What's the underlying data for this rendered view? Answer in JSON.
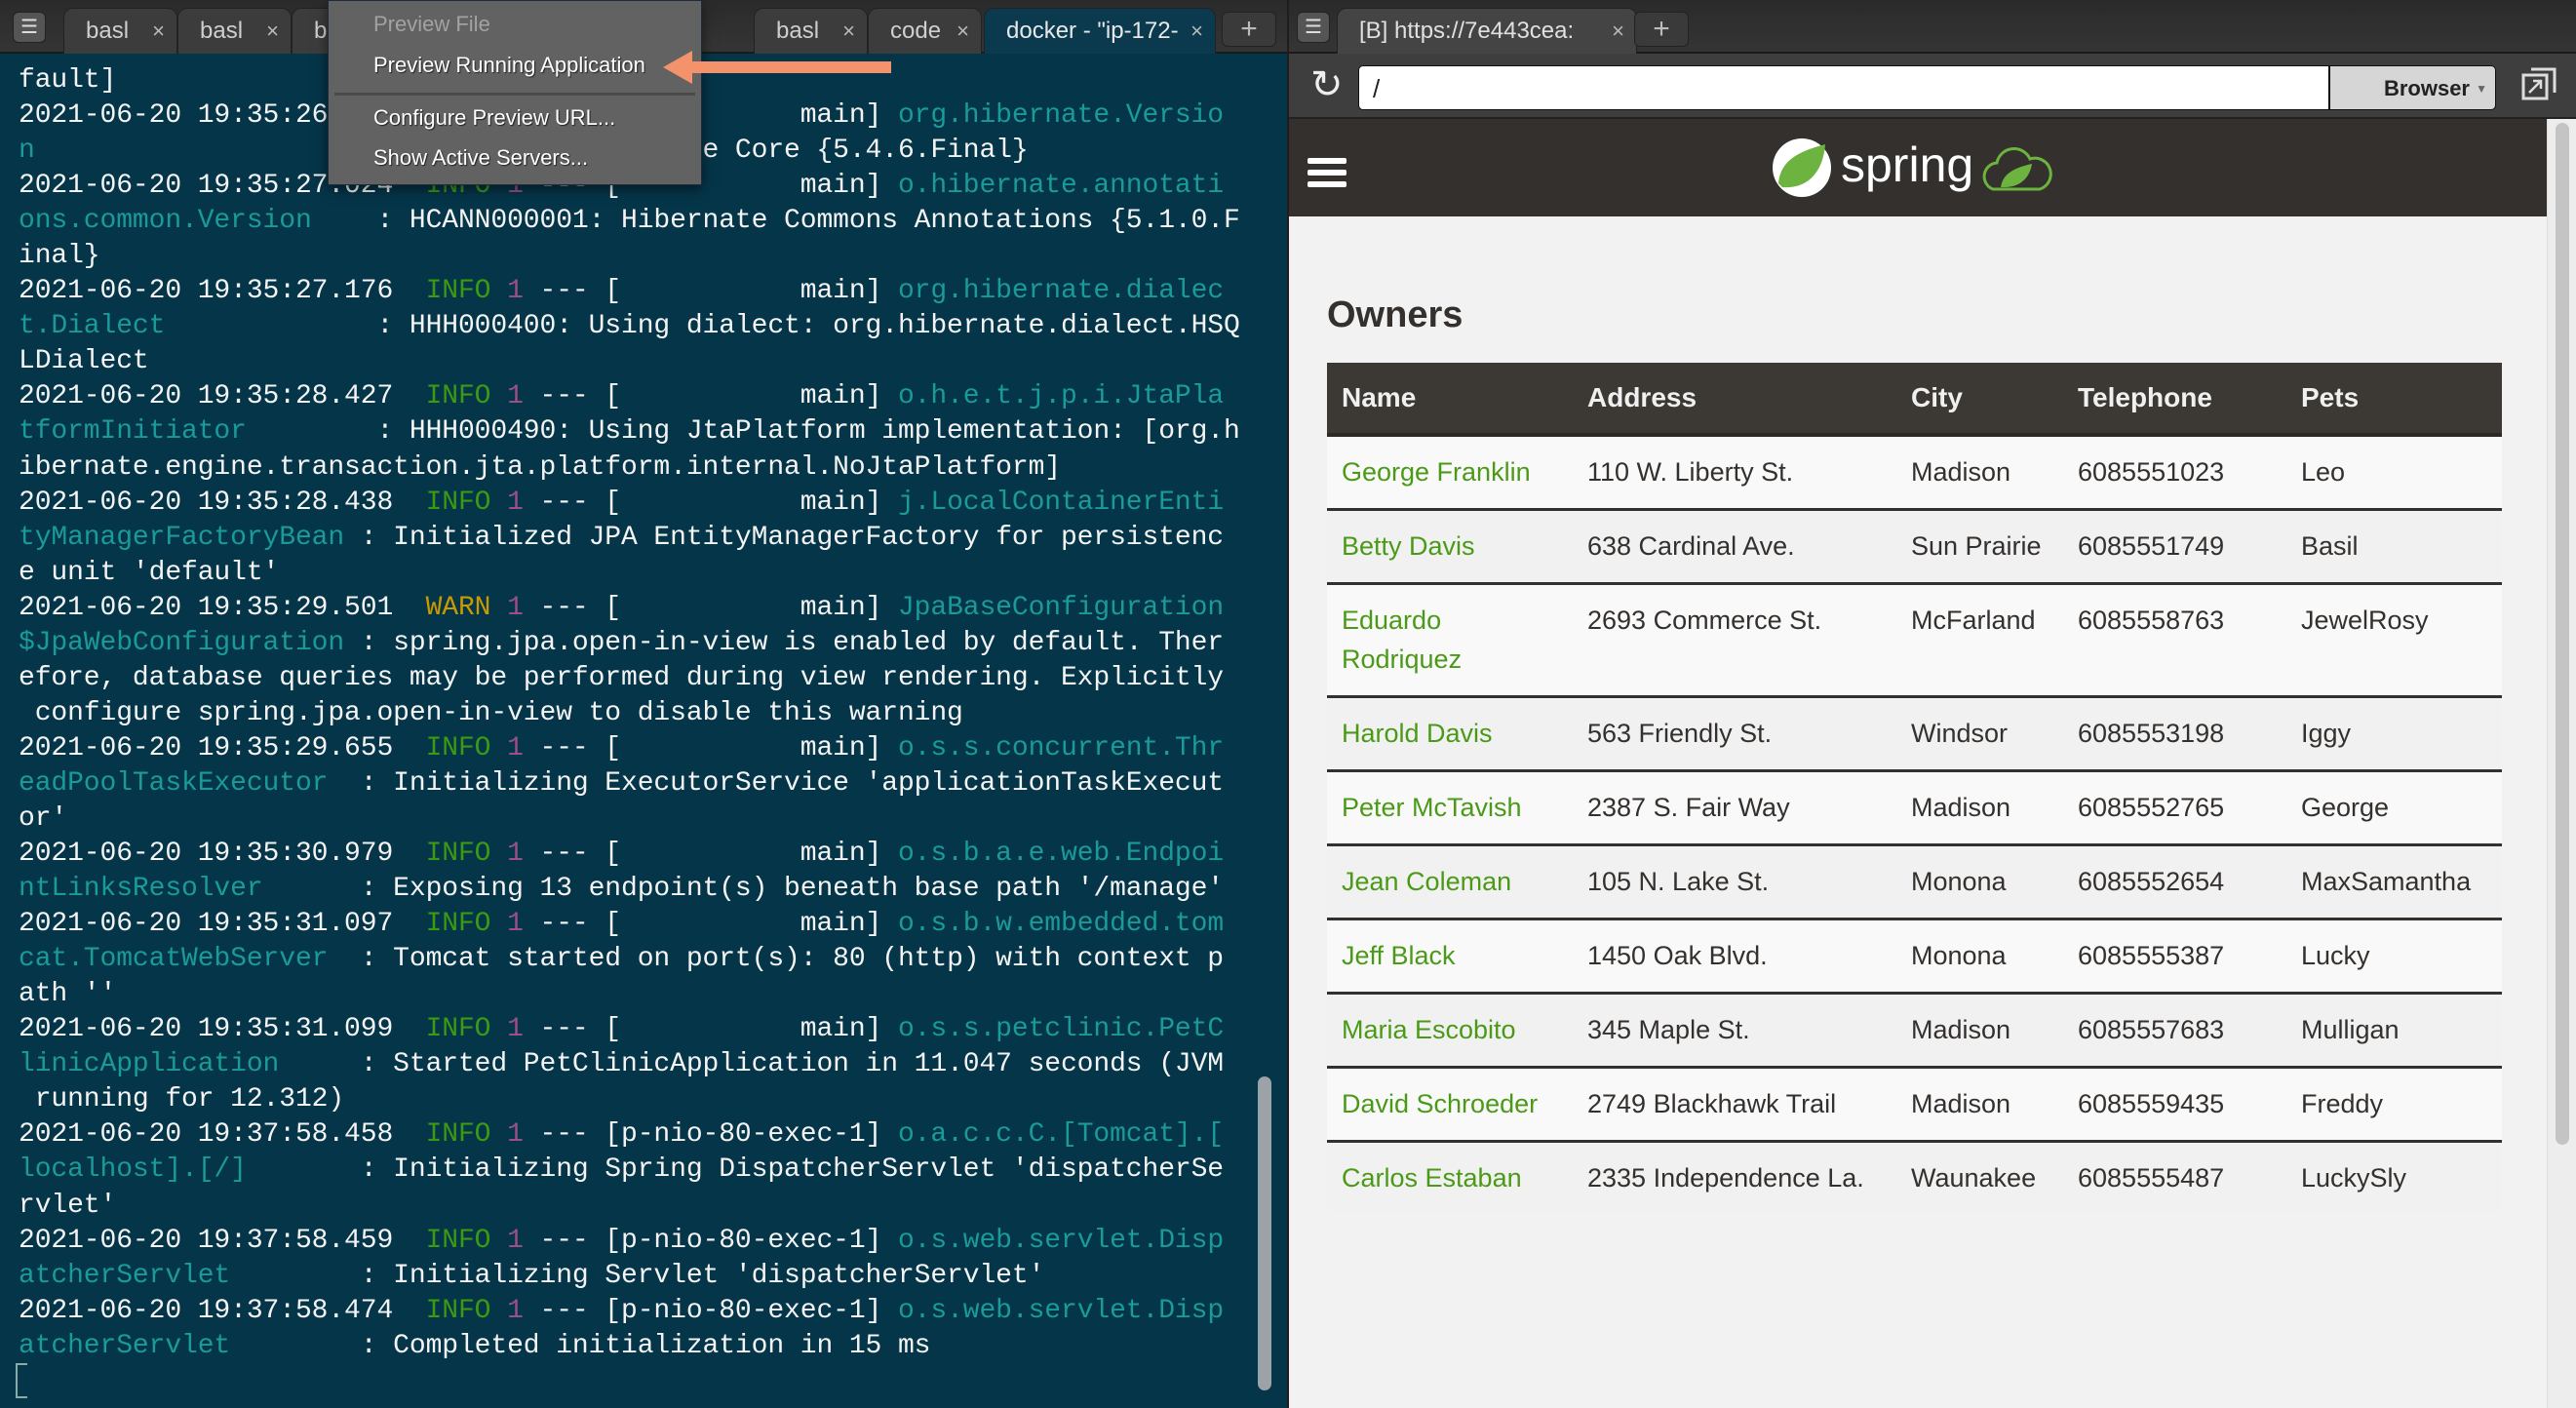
{
  "colors": {
    "terminal_bg": "#053549",
    "info": "#3a9a12",
    "warn": "#c79a00",
    "pid": "#9a4f86",
    "logger": "#1a9a98",
    "link_green": "#4b9a17",
    "spring_green": "#6db33f",
    "header_dark": "#34302d",
    "arrow": "#f4926c"
  },
  "left_tabs": [
    {
      "label": "basl",
      "active": false
    },
    {
      "label": "basl",
      "active": false
    },
    {
      "label": "b",
      "active": false
    },
    {
      "label": "",
      "active": false
    },
    {
      "label": "basl",
      "active": false
    },
    {
      "label": "code",
      "active": false
    },
    {
      "label": "docker - \"ip-172-",
      "active": true
    }
  ],
  "preview_menu": {
    "items": [
      {
        "label": "Preview File",
        "disabled": true
      },
      {
        "label": "Preview Running Application",
        "disabled": false
      },
      {
        "label": "Configure Preview URL...",
        "disabled": false
      },
      {
        "label": "Show Active Servers...",
        "disabled": false
      }
    ]
  },
  "terminal": {
    "lines": [
      [
        {
          "t": "fault]",
          "c": "w"
        }
      ],
      [
        {
          "t": "2021-06-20 19:35:26                             main] ",
          "c": "w"
        },
        {
          "t": "org.hibernate.Versio",
          "c": "t"
        }
      ],
      [
        {
          "t": "n",
          "c": "t"
        },
        {
          "t": "                                        te Core {5.4.6.Final}",
          "c": "w"
        }
      ],
      [
        {
          "t": "2021-06-20 19:35:27.024  ",
          "c": "w"
        },
        {
          "t": "INFO",
          "c": "g"
        },
        {
          "t": " ",
          "c": "w"
        },
        {
          "t": "1",
          "c": "p"
        },
        {
          "t": " --- [           main] ",
          "c": "w"
        },
        {
          "t": "o.hibernate.annotati",
          "c": "t"
        }
      ],
      [
        {
          "t": "ons.common.Version",
          "c": "t"
        },
        {
          "t": "    : HCANN000001: Hibernate Commons Annotations {5.1.0.F",
          "c": "w"
        }
      ],
      [
        {
          "t": "inal}",
          "c": "w"
        }
      ],
      [
        {
          "t": "2021-06-20 19:35:27.176  ",
          "c": "w"
        },
        {
          "t": "INFO",
          "c": "g"
        },
        {
          "t": " ",
          "c": "w"
        },
        {
          "t": "1",
          "c": "p"
        },
        {
          "t": " --- [           main] ",
          "c": "w"
        },
        {
          "t": "org.hibernate.dialec",
          "c": "t"
        }
      ],
      [
        {
          "t": "t.Dialect",
          "c": "t"
        },
        {
          "t": "             : HHH000400: Using dialect: org.hibernate.dialect.HSQ",
          "c": "w"
        }
      ],
      [
        {
          "t": "LDialect",
          "c": "w"
        }
      ],
      [
        {
          "t": "2021-06-20 19:35:28.427  ",
          "c": "w"
        },
        {
          "t": "INFO",
          "c": "g"
        },
        {
          "t": " ",
          "c": "w"
        },
        {
          "t": "1",
          "c": "p"
        },
        {
          "t": " --- [           main] ",
          "c": "w"
        },
        {
          "t": "o.h.e.t.j.p.i.JtaPla",
          "c": "t"
        }
      ],
      [
        {
          "t": "tformInitiator",
          "c": "t"
        },
        {
          "t": "        : HHH000490: Using JtaPlatform implementation: [org.h",
          "c": "w"
        }
      ],
      [
        {
          "t": "ibernate.engine.transaction.jta.platform.internal.NoJtaPlatform]",
          "c": "w"
        }
      ],
      [
        {
          "t": "2021-06-20 19:35:28.438  ",
          "c": "w"
        },
        {
          "t": "INFO",
          "c": "g"
        },
        {
          "t": " ",
          "c": "w"
        },
        {
          "t": "1",
          "c": "p"
        },
        {
          "t": " --- [           main] ",
          "c": "w"
        },
        {
          "t": "j.LocalContainerEnti",
          "c": "t"
        }
      ],
      [
        {
          "t": "tyManagerFactoryBean",
          "c": "t"
        },
        {
          "t": " : Initialized JPA EntityManagerFactory for persistenc",
          "c": "w"
        }
      ],
      [
        {
          "t": "e unit 'default'",
          "c": "w"
        }
      ],
      [
        {
          "t": "2021-06-20 19:35:29.501  ",
          "c": "w"
        },
        {
          "t": "WARN",
          "c": "y"
        },
        {
          "t": " ",
          "c": "w"
        },
        {
          "t": "1",
          "c": "p"
        },
        {
          "t": " --- [           main] ",
          "c": "w"
        },
        {
          "t": "JpaBaseConfiguration",
          "c": "t"
        }
      ],
      [
        {
          "t": "$JpaWebConfiguration",
          "c": "t"
        },
        {
          "t": " : spring.jpa.open-in-view is enabled by default. Ther",
          "c": "w"
        }
      ],
      [
        {
          "t": "efore, database queries may be performed during view rendering. Explicitly",
          "c": "w"
        }
      ],
      [
        {
          "t": " configure spring.jpa.open-in-view to disable this warning",
          "c": "w"
        }
      ],
      [
        {
          "t": "2021-06-20 19:35:29.655  ",
          "c": "w"
        },
        {
          "t": "INFO",
          "c": "g"
        },
        {
          "t": " ",
          "c": "w"
        },
        {
          "t": "1",
          "c": "p"
        },
        {
          "t": " --- [           main] ",
          "c": "w"
        },
        {
          "t": "o.s.s.concurrent.Thr",
          "c": "t"
        }
      ],
      [
        {
          "t": "eadPoolTaskExecutor",
          "c": "t"
        },
        {
          "t": "  : Initializing ExecutorService 'applicationTaskExecut",
          "c": "w"
        }
      ],
      [
        {
          "t": "or'",
          "c": "w"
        }
      ],
      [
        {
          "t": "2021-06-20 19:35:30.979  ",
          "c": "w"
        },
        {
          "t": "INFO",
          "c": "g"
        },
        {
          "t": " ",
          "c": "w"
        },
        {
          "t": "1",
          "c": "p"
        },
        {
          "t": " --- [           main] ",
          "c": "w"
        },
        {
          "t": "o.s.b.a.e.web.Endpoi",
          "c": "t"
        }
      ],
      [
        {
          "t": "ntLinksResolver",
          "c": "t"
        },
        {
          "t": "      : Exposing 13 endpoint(s) beneath base path '/manage'",
          "c": "w"
        }
      ],
      [
        {
          "t": "2021-06-20 19:35:31.097  ",
          "c": "w"
        },
        {
          "t": "INFO",
          "c": "g"
        },
        {
          "t": " ",
          "c": "w"
        },
        {
          "t": "1",
          "c": "p"
        },
        {
          "t": " --- [           main] ",
          "c": "w"
        },
        {
          "t": "o.s.b.w.embedded.tom",
          "c": "t"
        }
      ],
      [
        {
          "t": "cat.TomcatWebServer",
          "c": "t"
        },
        {
          "t": "  : Tomcat started on port(s): 80 (http) with context p",
          "c": "w"
        }
      ],
      [
        {
          "t": "ath ''",
          "c": "w"
        }
      ],
      [
        {
          "t": "2021-06-20 19:35:31.099  ",
          "c": "w"
        },
        {
          "t": "INFO",
          "c": "g"
        },
        {
          "t": " ",
          "c": "w"
        },
        {
          "t": "1",
          "c": "p"
        },
        {
          "t": " --- [           main] ",
          "c": "w"
        },
        {
          "t": "o.s.s.petclinic.PetC",
          "c": "t"
        }
      ],
      [
        {
          "t": "linicApplication",
          "c": "t"
        },
        {
          "t": "     : Started PetClinicApplication in 11.047 seconds (JVM",
          "c": "w"
        }
      ],
      [
        {
          "t": " running for 12.312)",
          "c": "w"
        }
      ],
      [
        {
          "t": "2021-06-20 19:37:58.458  ",
          "c": "w"
        },
        {
          "t": "INFO",
          "c": "g"
        },
        {
          "t": " ",
          "c": "w"
        },
        {
          "t": "1",
          "c": "p"
        },
        {
          "t": " --- [p-nio-80-exec-1] ",
          "c": "w"
        },
        {
          "t": "o.a.c.c.C.[Tomcat].[",
          "c": "t"
        }
      ],
      [
        {
          "t": "localhost].[/]",
          "c": "t"
        },
        {
          "t": "       : Initializing Spring DispatcherServlet 'dispatcherSe",
          "c": "w"
        }
      ],
      [
        {
          "t": "rvlet'",
          "c": "w"
        }
      ],
      [
        {
          "t": "2021-06-20 19:37:58.459  ",
          "c": "w"
        },
        {
          "t": "INFO",
          "c": "g"
        },
        {
          "t": " ",
          "c": "w"
        },
        {
          "t": "1",
          "c": "p"
        },
        {
          "t": " --- [p-nio-80-exec-1] ",
          "c": "w"
        },
        {
          "t": "o.s.web.servlet.Disp",
          "c": "t"
        }
      ],
      [
        {
          "t": "atcherServlet",
          "c": "t"
        },
        {
          "t": "        : Initializing Servlet 'dispatcherServlet'",
          "c": "w"
        }
      ],
      [
        {
          "t": "2021-06-20 19:37:58.474  ",
          "c": "w"
        },
        {
          "t": "INFO",
          "c": "g"
        },
        {
          "t": " ",
          "c": "w"
        },
        {
          "t": "1",
          "c": "p"
        },
        {
          "t": " --- [p-nio-80-exec-1] ",
          "c": "w"
        },
        {
          "t": "o.s.web.servlet.Disp",
          "c": "t"
        }
      ],
      [
        {
          "t": "atcherServlet",
          "c": "t"
        },
        {
          "t": "        : Completed initialization in 15 ms",
          "c": "w"
        }
      ]
    ]
  },
  "browser": {
    "tab_label": "[B] https://7e443cea:",
    "url_value": "/",
    "mode_select": "Browser",
    "logo_text": "spring",
    "page_title": "Owners",
    "table": {
      "columns": [
        "Name",
        "Address",
        "City",
        "Telephone",
        "Pets"
      ],
      "rows": [
        [
          "George Franklin",
          "110 W. Liberty St.",
          "Madison",
          "6085551023",
          "Leo"
        ],
        [
          "Betty Davis",
          "638 Cardinal Ave.",
          "Sun Prairie",
          "6085551749",
          "Basil"
        ],
        [
          "Eduardo Rodriquez",
          "2693 Commerce St.",
          "McFarland",
          "6085558763",
          "JewelRosy"
        ],
        [
          "Harold Davis",
          "563 Friendly St.",
          "Windsor",
          "6085553198",
          "Iggy"
        ],
        [
          "Peter McTavish",
          "2387 S. Fair Way",
          "Madison",
          "6085552765",
          "George"
        ],
        [
          "Jean Coleman",
          "105 N. Lake St.",
          "Monona",
          "6085552654",
          "MaxSamantha"
        ],
        [
          "Jeff Black",
          "1450 Oak Blvd.",
          "Monona",
          "6085555387",
          "Lucky"
        ],
        [
          "Maria Escobito",
          "345 Maple St.",
          "Madison",
          "6085557683",
          "Mulligan"
        ],
        [
          "David Schroeder",
          "2749 Blackhawk Trail",
          "Madison",
          "6085559435",
          "Freddy"
        ],
        [
          "Carlos Estaban",
          "2335 Independence La.",
          "Waunakee",
          "6085555487",
          "LuckySly"
        ]
      ]
    }
  }
}
